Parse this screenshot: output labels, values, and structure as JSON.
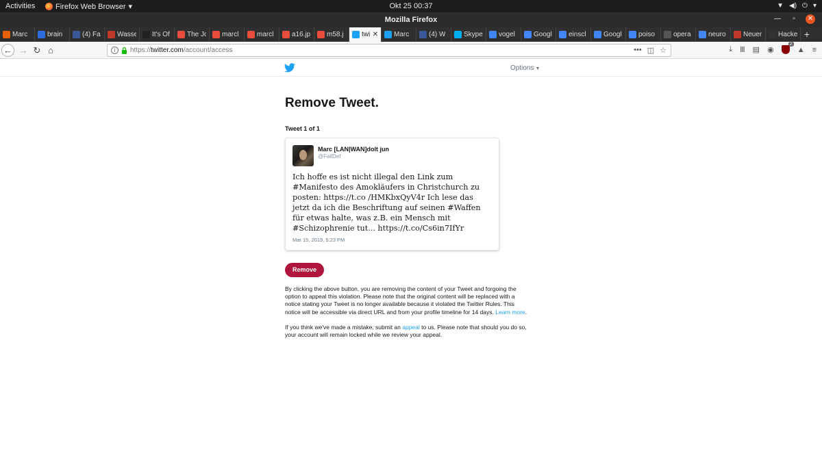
{
  "system": {
    "activities": "Activities",
    "app_menu": "Firefox Web Browser",
    "clock": "Okt 25  00:37"
  },
  "window": {
    "title": "Mozilla Firefox"
  },
  "tabs": [
    {
      "label": "Marc",
      "color": "#e66000"
    },
    {
      "label": "brain",
      "color": "#2d6cdf"
    },
    {
      "label": "(4) Fa",
      "color": "#3b5998"
    },
    {
      "label": "Wasse",
      "color": "#c0392b"
    },
    {
      "label": "It's Of",
      "color": "#222222"
    },
    {
      "label": "The Jo",
      "color": "#e74c3c"
    },
    {
      "label": "marcl",
      "color": "#e74c3c"
    },
    {
      "label": "marcl",
      "color": "#e74c3c"
    },
    {
      "label": "a16.jp",
      "color": "#e74c3c"
    },
    {
      "label": "m58.j",
      "color": "#e74c3c"
    },
    {
      "label": "twi",
      "color": "#1da1f2",
      "active": true
    },
    {
      "label": "Marc",
      "color": "#1da1f2"
    },
    {
      "label": "(4) W",
      "color": "#3b5998"
    },
    {
      "label": "Skype",
      "color": "#00aff0"
    },
    {
      "label": "vogel",
      "color": "#4285f4"
    },
    {
      "label": "Googl",
      "color": "#4285f4"
    },
    {
      "label": "einscl",
      "color": "#4285f4"
    },
    {
      "label": "Googl",
      "color": "#4285f4"
    },
    {
      "label": "poiso",
      "color": "#4285f4"
    },
    {
      "label": "opera",
      "color": "#555555"
    },
    {
      "label": "neuro",
      "color": "#4285f4"
    },
    {
      "label": "Neuer",
      "color": "#c0392b"
    },
    {
      "label": "Hacke",
      "color": "#333333"
    }
  ],
  "nav": {
    "url_prefix": "https://",
    "url_host": "twitter.com",
    "url_path": "/account/access"
  },
  "twitter": {
    "options_label": "Options",
    "page_title": "Remove Tweet.",
    "tweet_count": "Tweet 1 of 1",
    "tweet": {
      "name": "Marc [LAN|WAN]dolt jun",
      "handle": "@FailDef",
      "text": "Ich hoffe es ist nicht illegal den Link zum #Manifesto des Amokläufers in Christchurch zu posten: https://t.co /HMKbxQyV4r Ich lese das jetzt da ich die Beschriftung auf seinen #Waffen für etwas halte, was z.B. ein Mensch mit #Schizophrenie tut... https://t.co/Cs6in7IfYr",
      "date": "Mar 15, 2019, 5:23 PM"
    },
    "remove_button": "Remove",
    "para1_text": "By clicking the above button, you are removing the content of your Tweet and forgoing the option to appeal this violation. Please note that the original content will be replaced with a notice stating your Tweet is no longer available because it violated the Twitter Rules. This notice will be accessible via direct URL and from your profile timeline for 14 days. ",
    "para1_link": "Learn more",
    "para1_end": ".",
    "para2_start": "If you think we've made a mistake, submit an ",
    "para2_link": "appeal",
    "para2_end": " to us. Please note that should you do so, your account will remain locked while we review your appeal."
  },
  "colors": {
    "twitter_blue": "#1da1f2",
    "remove_red": "#b0153d"
  }
}
